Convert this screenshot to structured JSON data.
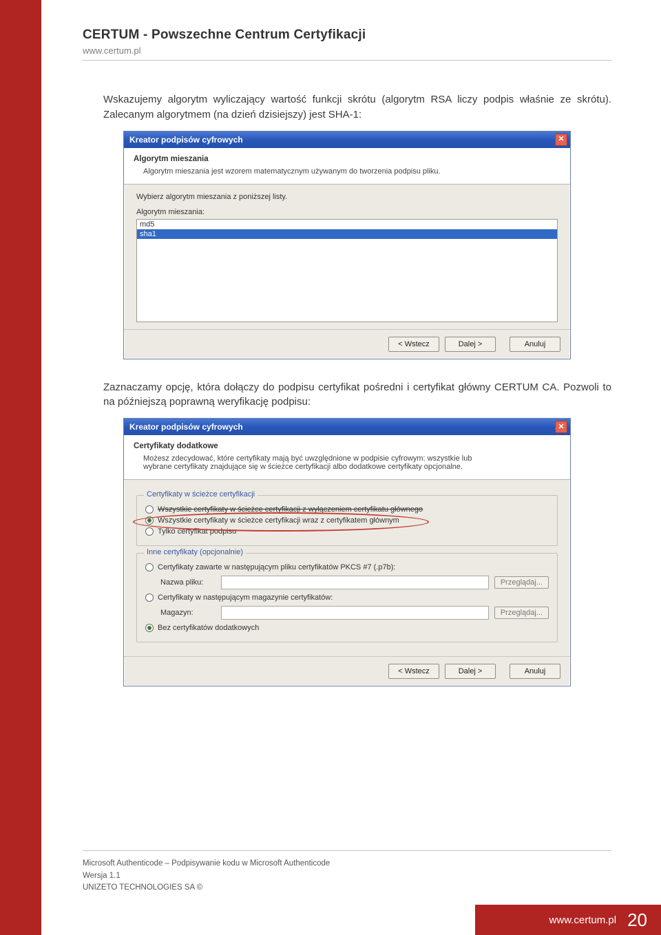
{
  "masthead": {
    "title": "CERTUM - Powszechne Centrum Certyfikacji",
    "url": "www.certum.pl"
  },
  "paragraphs": {
    "p1": "Wskazujemy algorytm wyliczający wartość funkcji skrótu (algorytm RSA liczy podpis właśnie ze skrótu). Zalecanym algorytmem (na dzień dzisiejszy) jest SHA-1:",
    "p2": "Zaznaczamy opcję, która dołączy do podpisu certyfikat pośredni i certyfikat główny CERTUM CA. Pozwoli to na późniejszą poprawną weryfikację podpisu:"
  },
  "dialog1": {
    "window_title": "Kreator podpisów cyfrowych",
    "header_title": "Algorytm mieszania",
    "header_desc": "Algorytm mieszania jest wzorem matematycznym używanym do tworzenia podpisu pliku.",
    "prompt": "Wybierz algorytm mieszania z poniższej listy.",
    "list_label": "Algorytm mieszania:",
    "options": {
      "md5": "md5",
      "sha1": "sha1"
    },
    "buttons": {
      "back": "< Wstecz",
      "next": "Dalej >",
      "cancel": "Anuluj"
    }
  },
  "dialog2": {
    "window_title": "Kreator podpisów cyfrowych",
    "header_title": "Certyfikaty dodatkowe",
    "header_desc": "Możesz zdecydować, które certyfikaty mają być uwzględnione w podpisie cyfrowym: wszystkie lub wybrane certyfikaty znajdujące się w ścieżce certyfikacji albo dodatkowe certyfikaty opcjonalne.",
    "group1": {
      "label": "Certyfikaty w ścieżce certyfikacji",
      "opt1": "Wszystkie certyfikaty w ścieżce certyfikacji z wyłączeniem certyfikatu głównego",
      "opt2": "Wszystkie certyfikaty w ścieżce certyfikacji wraz z certyfikatem głównym",
      "opt3": "Tylko certyfikat podpisu"
    },
    "group2": {
      "label": "Inne certyfikaty (opcjonalnie)",
      "opt1": "Certyfikaty zawarte w następującym pliku certyfikatów PKCS #7 (.p7b):",
      "file_label": "Nazwa pliku:",
      "browse1": "Przeglądaj...",
      "opt2": "Certyfikaty w następującym magazynie certyfikatów:",
      "store_label": "Magazyn:",
      "browse2": "Przeglądaj...",
      "opt3": "Bez certyfikatów dodatkowych"
    },
    "buttons": {
      "back": "< Wstecz",
      "next": "Dalej >",
      "cancel": "Anuluj"
    }
  },
  "footer": {
    "line1": "Microsoft Authenticode  – Podpisywanie kodu w Microsoft Authenticode",
    "line2": "Wersja 1.1",
    "line3": "UNIZETO TECHNOLOGIES SA ©",
    "url": "www.certum.pl",
    "page": "20"
  }
}
